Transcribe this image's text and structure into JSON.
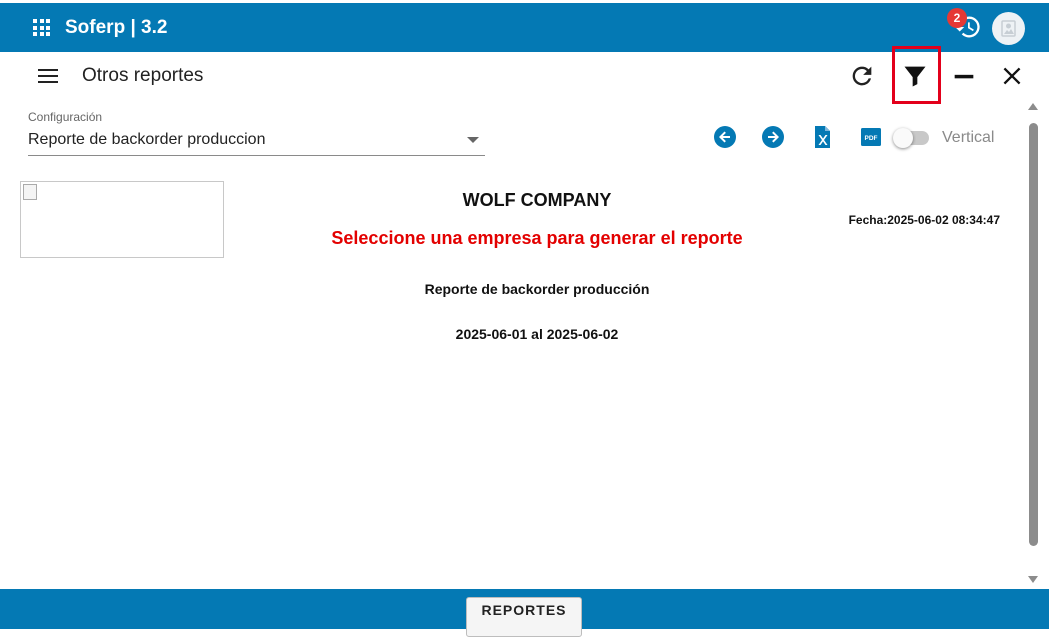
{
  "app": {
    "title": "Soferp | 3.2",
    "notifications_count": "2"
  },
  "toolbar": {
    "title": "Otros reportes"
  },
  "config": {
    "label": "Configuración",
    "selected": "Reporte de backorder produccion"
  },
  "orientation": {
    "label": "Vertical",
    "enabled": false
  },
  "report": {
    "company": "WOLF COMPANY",
    "warning": "Seleccione una empresa para generar el reporte",
    "date": "Fecha:2025-06-02 08:34:47",
    "name": "Reporte de backorder producción",
    "range": "2025-06-01 al 2025-06-02"
  },
  "footer": {
    "button_label": "REPORTES"
  },
  "colors": {
    "primary": "#0479b4",
    "warning": "#e30000",
    "highlight": "#e3001b",
    "badge": "#e53935"
  },
  "icons": [
    "apps-grid-icon",
    "history-icon",
    "avatar-icon",
    "menu-icon",
    "refresh-icon",
    "filter-icon",
    "minimize-icon",
    "close-icon",
    "arrow-left-circle-icon",
    "arrow-right-circle-icon",
    "excel-file-icon",
    "pdf-file-icon"
  ]
}
